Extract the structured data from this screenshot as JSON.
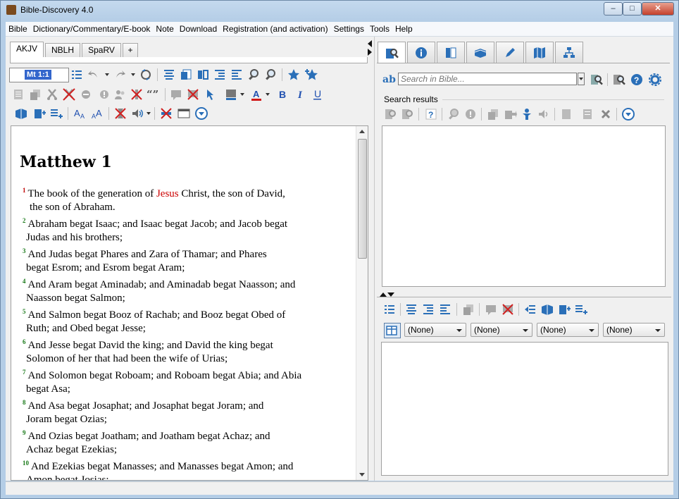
{
  "window": {
    "title": "Bible-Discovery 4.0",
    "minimize": "–",
    "maximize": "□",
    "close": "✕"
  },
  "menu": [
    "Bible",
    "Dictionary/Commentary/E-book",
    "Note",
    "Download",
    "Registration (and activation)",
    "Settings",
    "Tools",
    "Help"
  ],
  "bible_tabs": [
    "AKJV",
    "NBLH",
    "SpaRV",
    "+"
  ],
  "active_bible_tab": "AKJV",
  "reference_input": {
    "value": "Mt 1:1"
  },
  "text": {
    "chapter_title": "Matthew 1",
    "verses": [
      {
        "num": "1",
        "pre": "The book of the generation of ",
        "red": "Jesus",
        "post": " Christ, the son of David,",
        "line2": "the son of Abraham."
      },
      {
        "num": "2",
        "pre": "Abraham begat Isaac; and Isaac begat Jacob; and Jacob begat",
        "red": "",
        "post": "",
        "line2": "Judas and his brothers;"
      },
      {
        "num": "3",
        "pre": "And Judas begat Phares and Zara of Thamar; and Phares",
        "red": "",
        "post": "",
        "line2": "begat Esrom; and Esrom begat Aram;"
      },
      {
        "num": "4",
        "pre": "And Aram begat Aminadab; and Aminadab begat Naasson; and",
        "red": "",
        "post": "",
        "line2": "Naasson begat Salmon;"
      },
      {
        "num": "5",
        "pre": "And Salmon begat Booz of Rachab; and Booz begat Obed of",
        "red": "",
        "post": "",
        "line2": "Ruth; and Obed begat Jesse;"
      },
      {
        "num": "6",
        "pre": "And Jesse begat David the king; and David the king begat",
        "red": "",
        "post": "",
        "line2": "Solomon of her that had been the wife of Urias;"
      },
      {
        "num": "7",
        "pre": "And Solomon begat Roboam; and Roboam begat Abia; and Abia",
        "red": "",
        "post": "",
        "line2": "begat Asa;"
      },
      {
        "num": "8",
        "pre": "And Asa begat Josaphat; and Josaphat begat Joram; and",
        "red": "",
        "post": "",
        "line2": "Joram begat Ozias;"
      },
      {
        "num": "9",
        "pre": "And Ozias begat Joatham; and Joatham begat Achaz; and",
        "red": "",
        "post": "",
        "line2": "Achaz begat Ezekias;"
      },
      {
        "num": "10",
        "pre": "And Ezekias begat Manasses; and Manasses begat Amon; and",
        "red": "",
        "post": "",
        "line2": "Amon begat Josias;"
      }
    ]
  },
  "search": {
    "ab_label": "ab",
    "placeholder": "Search in Bible...",
    "results_label": "Search results"
  },
  "dropdowns": [
    "(None)",
    "(None)",
    "(None)",
    "(None)"
  ],
  "toolbar": {
    "quote_glyph": "“”"
  },
  "colors": {
    "accent_red": "#cc0000",
    "verse_number_green": "#1a7a1a",
    "highlight_blue": "#3366cc",
    "bold_blue": "#2050b0"
  }
}
